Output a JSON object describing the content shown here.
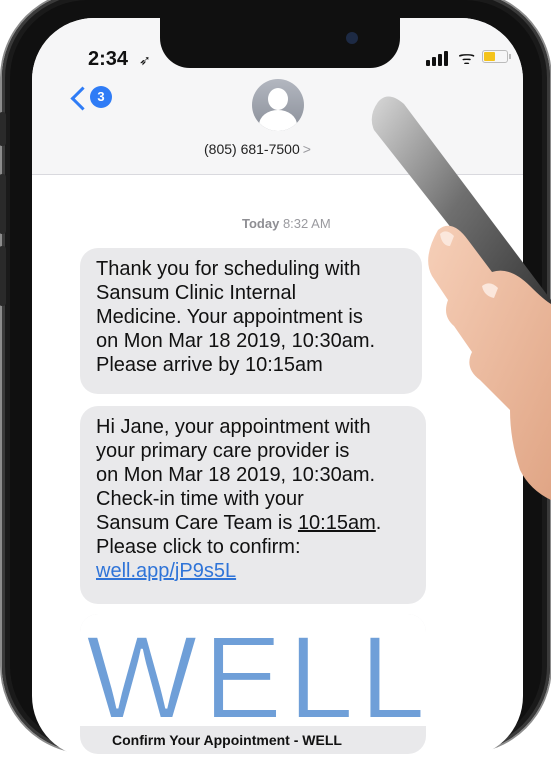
{
  "status_bar": {
    "time": "2:34",
    "battery_level": 0.55,
    "battery_color": "#f4c31b"
  },
  "header": {
    "back_badge_count": "3",
    "contact_number": "(805) 681-7500",
    "contact_chevron": ">"
  },
  "thread": {
    "timestamp_day": "Today",
    "timestamp_time": "8:32 AM",
    "messages": [
      {
        "lines": [
          "Thank you for scheduling with",
          "Sansum Clinic Internal",
          "Medicine. Your appointment is",
          "on Mon Mar 18 2019, 10:30am.",
          "Please arrive by 10:15am"
        ]
      },
      {
        "lines": [
          "Hi Jane, your appointment with",
          "your primary care provider is",
          "on Mon Mar 18 2019, 10:30am.",
          "Check-in time with your"
        ],
        "line5_prefix": "Sansum Care Team is ",
        "line5_time": "10:15am",
        "line5_suffix": ".",
        "line6": "Please click to confirm:",
        "link": "well.app/jP9s5L"
      }
    ],
    "card": {
      "logo_text": "WELL",
      "caption": "Confirm Your Appointment - WELL"
    }
  },
  "colors": {
    "accent": "#2f7cf6",
    "bubble_bg": "#e9e9eb",
    "logo_blue": "#6f9fd8",
    "link": "#2f74d8"
  }
}
